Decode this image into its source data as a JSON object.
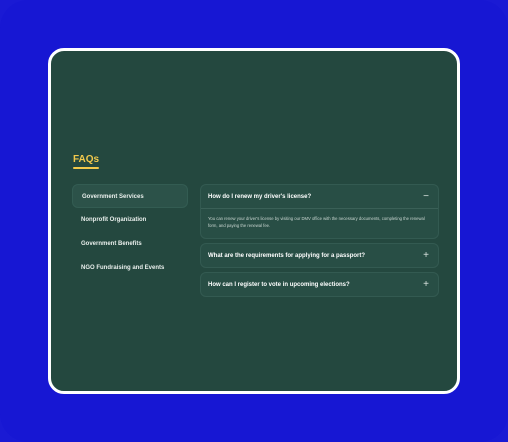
{
  "page": {
    "title": "FAQs"
  },
  "colors": {
    "background": "#1717d3",
    "card": "#24483f",
    "accent": "#f2c94c",
    "border": "#ffffff"
  },
  "sidebar": {
    "items": [
      {
        "label": "Government Services",
        "active": true
      },
      {
        "label": "Nonprofit Organization",
        "active": false
      },
      {
        "label": "Government Benefits",
        "active": false
      },
      {
        "label": "NGO Fundraising and Events",
        "active": false
      }
    ]
  },
  "faqs": [
    {
      "question": "How do I renew my driver's license?",
      "answer": "You can renew your driver's license by visiting our DMV office with the necessary documents, completing the renewal form, and paying the renewal fee.",
      "expanded": true,
      "toggle": "−"
    },
    {
      "question": "What are the requirements for applying for a passport?",
      "expanded": false,
      "toggle": "+"
    },
    {
      "question": "How can I register to vote in upcoming elections?",
      "expanded": false,
      "toggle": "+"
    }
  ]
}
